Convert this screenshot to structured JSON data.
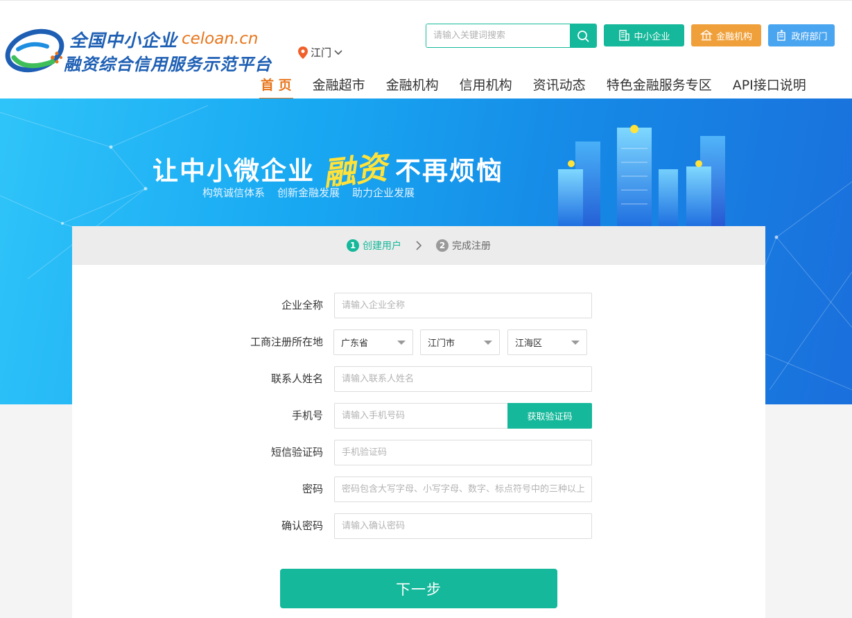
{
  "brand": {
    "line1": "全国中小企业",
    "domain": "celoan.cn",
    "line2": "融资综合信用服务示范平台"
  },
  "location": {
    "city": "江门"
  },
  "search": {
    "placeholder": "请输入关键词搜索"
  },
  "top_buttons": {
    "sme": "中小企业",
    "finance": "金融机构",
    "gov": "政府部门"
  },
  "nav": [
    {
      "label": "首 页",
      "active": true
    },
    {
      "label": "金融超市"
    },
    {
      "label": "金融机构"
    },
    {
      "label": "信用机构"
    },
    {
      "label": "资讯动态"
    },
    {
      "label": "特色金融服务专区"
    },
    {
      "label": "API接口说明"
    }
  ],
  "banner": {
    "slogan_prefix": "让中小微企业",
    "slogan_highlight": "融资",
    "slogan_suffix": "不再烦恼",
    "sub": [
      "构筑诚信体系",
      "创新金融发展",
      "助力企业发展"
    ]
  },
  "steps": [
    {
      "num": "1",
      "label": "创建用户",
      "state": "active"
    },
    {
      "num": "2",
      "label": "完成注册",
      "state": "pending"
    }
  ],
  "form": {
    "company_name": {
      "label": "企业全称",
      "placeholder": "请输入企业全称"
    },
    "location": {
      "label": "工商注册所在地",
      "province": "广东省",
      "city": "江门市",
      "district": "江海区"
    },
    "contact_name": {
      "label": "联系人姓名",
      "placeholder": "请输入联系人姓名"
    },
    "phone": {
      "label": "手机号",
      "placeholder": "请输入手机号码",
      "code_button": "获取验证码"
    },
    "sms_code": {
      "label": "短信验证码",
      "placeholder": "手机验证码"
    },
    "password": {
      "label": "密码",
      "placeholder": "密码包含大写字母、小写字母、数字、标点符号中的三种以上"
    },
    "confirm_password": {
      "label": "确认密码",
      "placeholder": "请输入确认密码"
    },
    "next_button": "下一步"
  },
  "colors": {
    "primary": "#15b89a",
    "brand_blue": "#1e5fb4",
    "accent_orange": "#e8751a",
    "finance_orange": "#f0a03a",
    "gov_blue": "#4aa5f0"
  }
}
